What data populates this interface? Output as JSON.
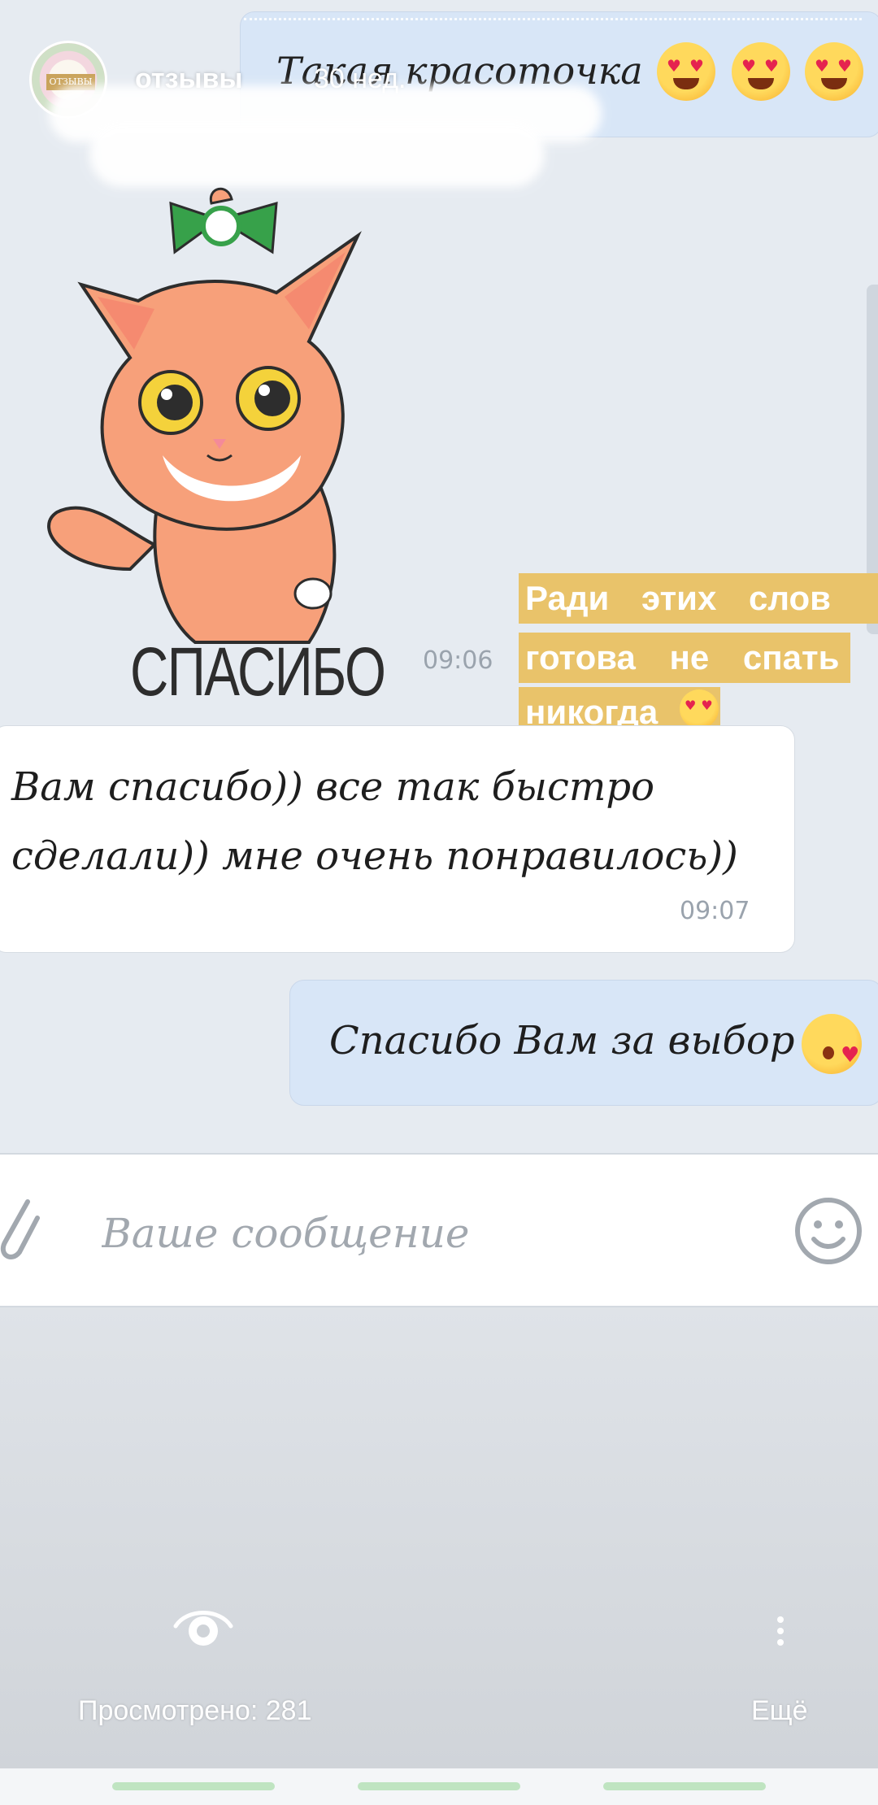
{
  "story": {
    "author": "отзывы",
    "age": "30 нед.",
    "avatar_text": "ОТЗЫВЫ"
  },
  "messages": {
    "top_outgoing": "Такая красоточка",
    "sticker_caption": "СПАСИБО",
    "sticker_time": "09:06",
    "highlight_lines": [
      "Ради этих слов я",
      "готова не спать",
      "никогда"
    ],
    "incoming_line1": "Вам спасибо)) все так быстро",
    "incoming_line2": "сделали)) мне очень понравилось))",
    "incoming_time": "09:07",
    "outgoing": "Спасибо Вам за выбор"
  },
  "composer": {
    "placeholder": "Ваше сообщение"
  },
  "footer": {
    "viewers_label": "Просмотрено: 281",
    "more_label": "Ещё"
  },
  "colors": {
    "outgoing_bubble": "#d8e6f7",
    "incoming_bubble": "#ffffff",
    "highlight": "#e9c36a",
    "background": "#e6ebf1"
  },
  "icons": [
    "attach-icon",
    "smile-icon",
    "eye-icon",
    "more-vertical-icon",
    "heart-eyes-emoji",
    "kiss-emoji"
  ]
}
